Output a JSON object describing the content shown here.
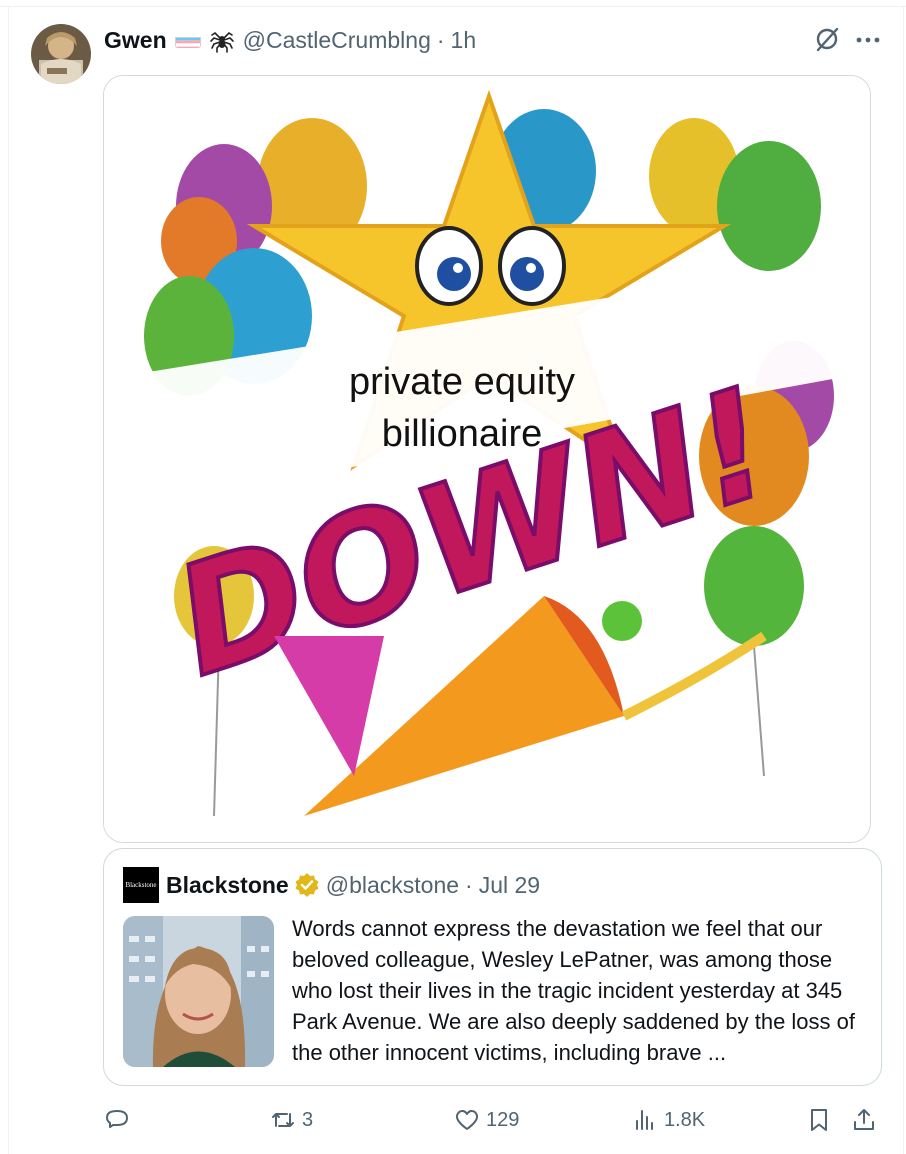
{
  "post": {
    "author_name": "Gwen",
    "author_handle": "@CastleCrumblng",
    "separator": "·",
    "time_ago": "1h",
    "icons": [
      "trans-flag-icon",
      "spider-icon",
      "grok-icon",
      "more-icon"
    ]
  },
  "media": {
    "caption_line1": "private equity",
    "caption_line2": "billionaire",
    "big_word": "DOWN!"
  },
  "quote": {
    "logo_text": "Blackstone",
    "author_name": "Blackstone",
    "author_handle": "@blackstone",
    "separator": "·",
    "date": "Jul 29",
    "text": "Words cannot express the devastation we feel that our beloved colleague, Wesley LePatner, was among those who lost their lives in the tragic incident yesterday at 345 Park Avenue. We are also deeply saddened by the loss of the other innocent victims, including brave ..."
  },
  "actions": {
    "reply_count": "",
    "repost_count": "3",
    "like_count": "129",
    "views_count": "1.8K"
  },
  "colors": {
    "text_primary": "#0f1419",
    "text_secondary": "#536471",
    "border": "#cfd9de",
    "verified_gold": "#e2b719"
  }
}
